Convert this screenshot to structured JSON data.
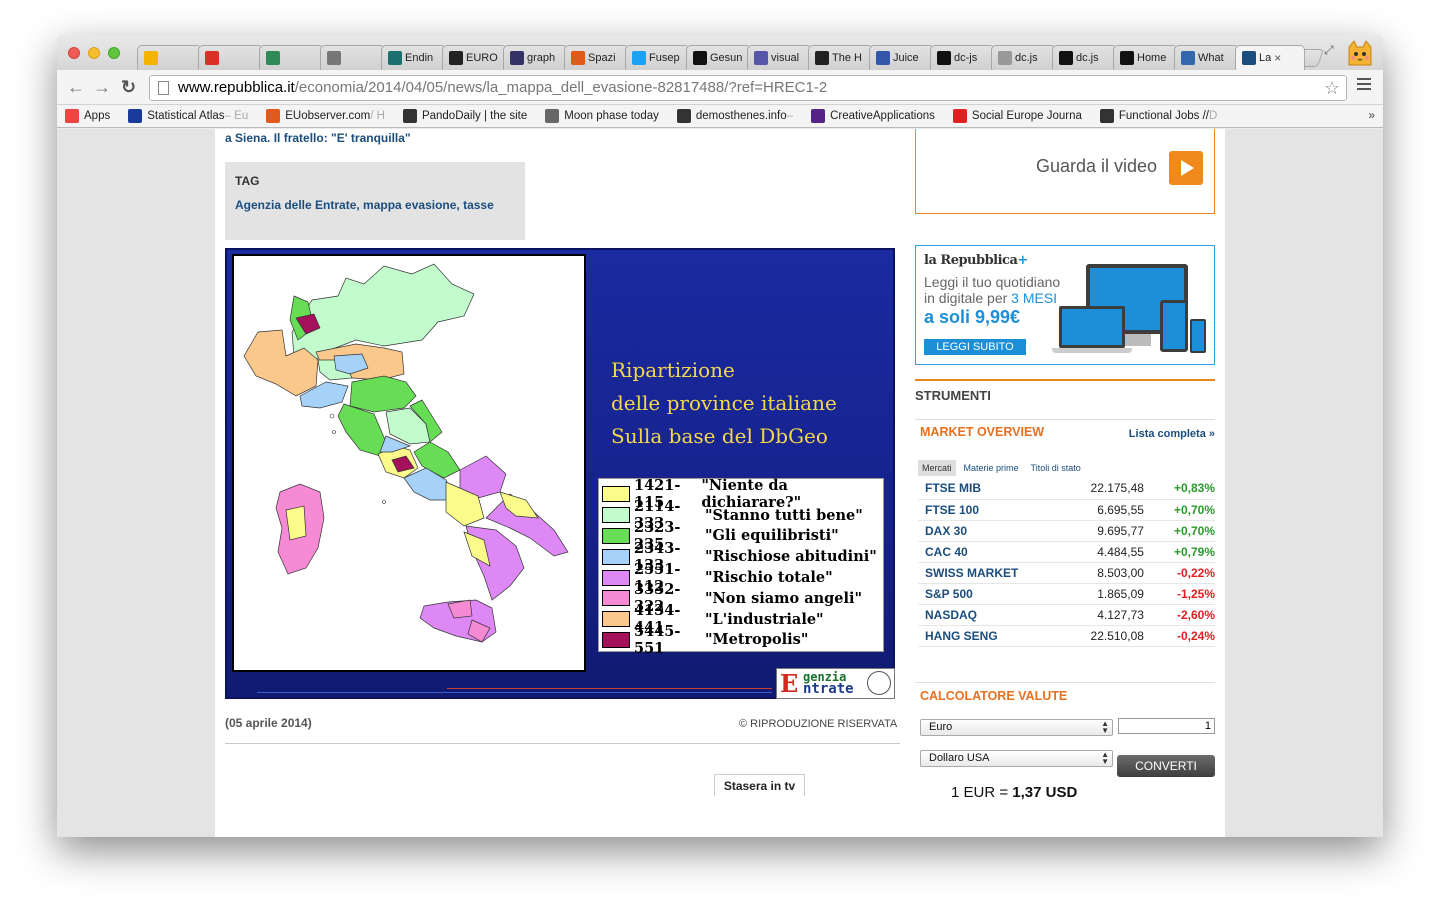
{
  "browser": {
    "tabs": [
      {
        "icon": "drive-icon",
        "label": "",
        "color": "#f4b400"
      },
      {
        "icon": "gmail-icon",
        "label": "",
        "color": "#d93025"
      },
      {
        "icon": "evernote-icon",
        "label": "",
        "color": "#2e8b57"
      },
      {
        "icon": "hash-icon",
        "label": "",
        "color": "#777777"
      },
      {
        "icon": "site-icon",
        "label": "Endin",
        "color": "#1b6f6f"
      },
      {
        "icon": "site-icon",
        "label": "EURO",
        "color": "#222222"
      },
      {
        "icon": "site-icon",
        "label": "graph",
        "color": "#333366"
      },
      {
        "icon": "site-icon",
        "label": "Spazi",
        "color": "#e05a1a"
      },
      {
        "icon": "twitter-icon",
        "label": "Fusep",
        "color": "#1da1f2"
      },
      {
        "icon": "site-icon",
        "label": "Gesun",
        "color": "#111111"
      },
      {
        "icon": "site-icon",
        "label": "visual",
        "color": "#5555aa"
      },
      {
        "icon": "site-icon",
        "label": "The H",
        "color": "#222222"
      },
      {
        "icon": "site-icon",
        "label": "Juice",
        "color": "#3355aa"
      },
      {
        "icon": "github-icon",
        "label": "dc-js",
        "color": "#111111"
      },
      {
        "icon": "page-icon",
        "label": "dc.js",
        "color": "#999999"
      },
      {
        "icon": "github-icon",
        "label": "dc.js",
        "color": "#111111"
      },
      {
        "icon": "github-icon",
        "label": "Home",
        "color": "#111111"
      },
      {
        "icon": "site-icon",
        "label": "What",
        "color": "#3366aa"
      },
      {
        "icon": "repubblica-icon",
        "label": "La",
        "color": "#1b4d7e",
        "active": true
      }
    ],
    "tab_close": "×",
    "url_host": "www.repubblica.it",
    "url_path": "/economia/2014/04/05/news/la_mappa_dell_evasione-82817488/?ref=HREC1-2",
    "back": "←",
    "forward": "→",
    "reload": "↻",
    "star": "☆",
    "bookmarks": [
      {
        "icon": "apps-icon",
        "label": "Apps",
        "faded": "",
        "color": "#e44"
      },
      {
        "icon": "eu-flag-icon",
        "label": "Statistical Atlas",
        "faded": " – Eu",
        "color": "#1a3a9c"
      },
      {
        "icon": "euobserver-icon",
        "label": "EUobserver.com",
        "faded": " / H",
        "color": "#e05a1a"
      },
      {
        "icon": "pando-icon",
        "label": "PandoDaily | the site",
        "faded": "",
        "color": "#333"
      },
      {
        "icon": "moon-icon",
        "label": "Moon phase today",
        "faded": "",
        "color": "#666"
      },
      {
        "icon": "demosthenes-icon",
        "label": "demosthenes.info",
        "faded": " –",
        "color": "#333"
      },
      {
        "icon": "creative-icon",
        "label": "CreativeApplications",
        "faded": "",
        "color": "#552288"
      },
      {
        "icon": "socialeurope-icon",
        "label": "Social Europe Journa",
        "faded": "",
        "color": "#d22"
      },
      {
        "icon": "lambda-icon",
        "label": "Functional Jobs // ",
        "faded": "D",
        "color": "#333"
      }
    ],
    "bookmarks_more": "»"
  },
  "article": {
    "news_tail": "a Siena. Il fratello: \"E' tranquilla\"",
    "tag_title": "TAG",
    "tag_links": "Agenzia delle Entrate, mappa evasione, tasse",
    "map_title_lines": [
      "Ripartizione",
      "delle province italiane",
      "Sulla base del DbGeo"
    ],
    "legend": [
      {
        "code": "1421-115",
        "label": "\"Niente da dichiarare?\"",
        "color": "#fbfb8c"
      },
      {
        "code": "2114-333",
        "label": "\"Stanno tutti bene\"",
        "color": "#c2fbcc"
      },
      {
        "code": "2323-235",
        "label": "\"Gli equilibristi\"",
        "color": "#66dd55"
      },
      {
        "code": "2343-133",
        "label": "\"Rischiose abitudini\"",
        "color": "#a6d2fa"
      },
      {
        "code": "2551-112",
        "label": "\"Rischio totale\"",
        "color": "#dd88f5"
      },
      {
        "code": "3332-322",
        "label": "\"Non siamo angeli\"",
        "color": "#f78ad5"
      },
      {
        "code": "4134-441",
        "label": "\"L'industriale\"",
        "color": "#fbc88c"
      },
      {
        "code": "5445-551",
        "label": "\"Metropolis\"",
        "color": "#a4105a"
      }
    ],
    "logo_line1": "genzia",
    "logo_line2": "ntrate",
    "logo_letter": "E",
    "date": "(05 aprile 2014)",
    "copyright": "© RIPRODUZIONE RISERVATA",
    "tv_tab": "Stasera in tv"
  },
  "sidebar": {
    "video_label": "Guarda il video",
    "promo": {
      "brand": "la Repubblica",
      "brand_plus": "+",
      "text_line1": "Leggi il tuo quotidiano",
      "text_line2_a": "in digitale per ",
      "text_line2_b": "3 MESI",
      "price": "a soli 9,99€",
      "button": "LEGGI SUBITO"
    },
    "strumenti": "STRUMENTI",
    "market": {
      "title": "MARKET OVERVIEW",
      "link": "Lista completa »",
      "tabs": [
        "Mercati",
        "Materie prime",
        "Titoli di stato"
      ],
      "rows": [
        {
          "name": "FTSE MIB",
          "value": "22.175,48",
          "change": "+0,83%",
          "up": true
        },
        {
          "name": "FTSE 100",
          "value": "6.695,55",
          "change": "+0,70%",
          "up": true
        },
        {
          "name": "DAX 30",
          "value": "9.695,77",
          "change": "+0,70%",
          "up": true
        },
        {
          "name": "CAC 40",
          "value": "4.484,55",
          "change": "+0,79%",
          "up": true
        },
        {
          "name": "SWISS MARKET",
          "value": "8.503,00",
          "change": "-0,22%",
          "up": false
        },
        {
          "name": "S&P 500",
          "value": "1.865,09",
          "change": "-1,25%",
          "up": false
        },
        {
          "name": "NASDAQ",
          "value": "4.127,73",
          "change": "-2,60%",
          "up": false
        },
        {
          "name": "HANG SENG",
          "value": "22.510,08",
          "change": "-0,24%",
          "up": false
        }
      ]
    },
    "converter": {
      "title": "CALCOLATORE VALUTE",
      "from": "Euro",
      "to": "Dollaro USA",
      "amount": "1",
      "button": "CONVERTI",
      "result_prefix": "1 EUR = ",
      "result_value": "1,37 USD"
    }
  }
}
